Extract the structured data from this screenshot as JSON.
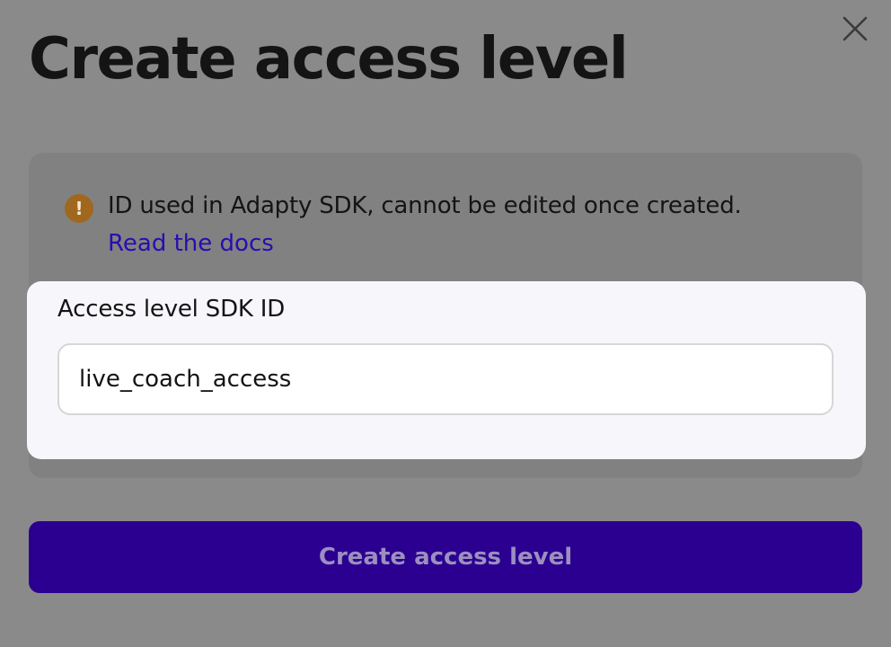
{
  "dialog": {
    "title": "Create access level",
    "close_icon": "close-icon"
  },
  "notice": {
    "icon": "warning-icon",
    "icon_glyph": "!",
    "text": "ID used in Adapty SDK, cannot be edited once created.",
    "link_label": "Read the docs"
  },
  "field": {
    "label": "Access level SDK ID",
    "value": "live_coach_access"
  },
  "actions": {
    "submit_label": "Create access level"
  },
  "colors": {
    "overlay": "#8a8a8a",
    "primary_button": "#2b0090",
    "primary_button_text": "#9c8fc0",
    "link": "#2a0cb0",
    "warning_icon": "#a0671f",
    "field_card": "#f7f6fb"
  }
}
